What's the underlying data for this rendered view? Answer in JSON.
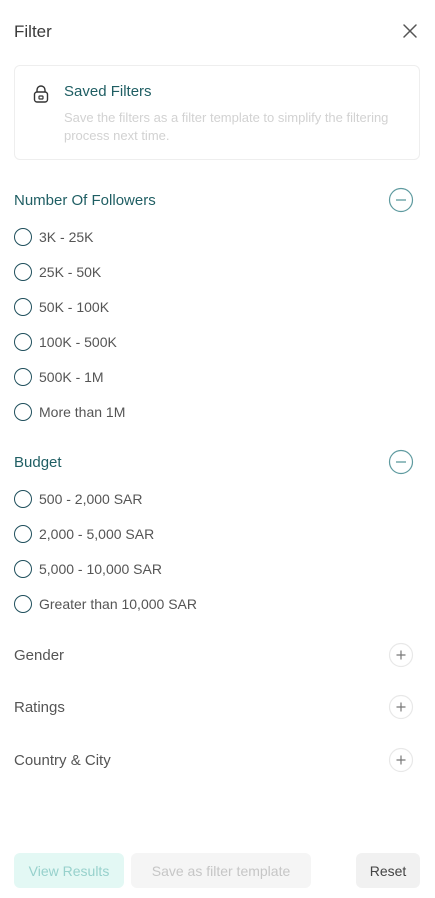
{
  "header": {
    "title": "Filter",
    "close_icon": "close-icon"
  },
  "saved_filters": {
    "title": "Saved Filters",
    "description": "Save the filters as a filter template to simplify the filtering process next time.",
    "icon": "lock-icon"
  },
  "sections": {
    "followers": {
      "title": "Number Of Followers",
      "expanded": true,
      "options": [
        "3K - 25K",
        "25K - 50K",
        "50K - 100K",
        "100K - 500K",
        "500K - 1M",
        "More than 1M"
      ]
    },
    "budget": {
      "title": "Budget",
      "expanded": true,
      "options": [
        "500 - 2,000 SAR",
        "2,000 - 5,000 SAR",
        "5,000 - 10,000 SAR",
        "Greater than 10,000 SAR"
      ]
    },
    "gender": {
      "title": "Gender",
      "expanded": false
    },
    "ratings": {
      "title": "Ratings",
      "expanded": false
    },
    "country_city": {
      "title": "Country & City",
      "expanded": false
    }
  },
  "footer": {
    "view_results": "View Results",
    "save_template": "Save as filter template",
    "reset": "Reset"
  },
  "colors": {
    "accent": "#1f5e63",
    "radio_border": "#1f4f5c",
    "toggle_active": "#5e9a9f",
    "view_bg": "#e3f8f4"
  }
}
